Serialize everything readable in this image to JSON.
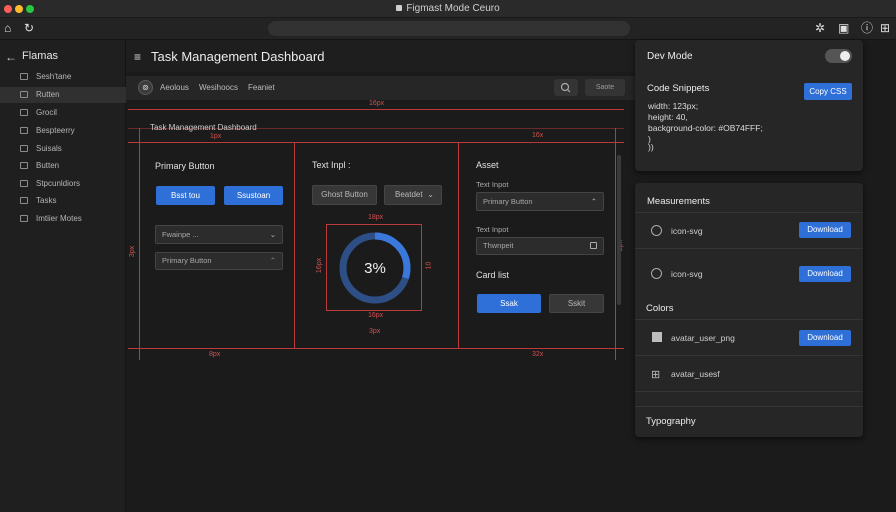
{
  "window": {
    "title": "Figmast Mode Ceuro"
  },
  "sidebar": {
    "title": "Flamas",
    "items": [
      {
        "label": "Sesh'tane"
      },
      {
        "label": "Rutten"
      },
      {
        "label": "Grocil"
      },
      {
        "label": "Bespteerry"
      },
      {
        "label": "Suisals"
      },
      {
        "label": "Butten"
      },
      {
        "label": "Stpcunldiors"
      },
      {
        "label": "Tasks"
      },
      {
        "label": "Imtiier Motes"
      }
    ]
  },
  "header": {
    "title": "Task Management Dashboard"
  },
  "subbar": {
    "tabs": [
      "Aeolous",
      "Wesihoocs",
      "Feaniet"
    ],
    "save_label": "Saote"
  },
  "canvas": {
    "frame_label": "Task Management Dashboard",
    "measure": {
      "top_16px": "16px",
      "top_1px": "1px",
      "right_16x": "16x",
      "left_3px": "3px",
      "bottom_8px": "8px",
      "bottom_32x": "32x",
      "inner_18px": "18px",
      "inner_16px_l": "16px",
      "inner_10": "10",
      "inner_16px_b": "16px",
      "inner_3px": "3px",
      "right_2px": "2px"
    },
    "primary": {
      "title": "Primary Button",
      "btn1": "Bsst tou",
      "btn2": "Ssustoan",
      "field1": "Fwainpe ...",
      "field2": "Primary Button"
    },
    "text_input": {
      "title": "Text Inpl :",
      "ghost_label": "Ghost Button",
      "dropdown_label": "Beatdet",
      "progress_value": "3%",
      "progress_fraction": 0.3
    },
    "asset": {
      "title": "Asset",
      "label1": "Text Inpot",
      "select_value": "Primary Button",
      "label2": "Text Inpot",
      "input_value": "Thwnpeit",
      "card_list_title": "Card list",
      "btn_primary": "Ssak",
      "btn_secondary": "Sskit"
    }
  },
  "right_panel": {
    "devmode": {
      "title": "Dev Mode",
      "snippets_title": "Code Snippets",
      "copy_label": "Copy CSS",
      "code": [
        "width: 123px;",
        "height: 40,",
        "background-color: #OB74FFF;",
        ")",
        "))"
      ]
    },
    "measurements": {
      "title": "Measurements",
      "rows": [
        {
          "label": "icon-svg",
          "button": "Download"
        },
        {
          "label": "icon-svg",
          "button": "Download"
        }
      ],
      "colors_title": "Colors",
      "color_rows": [
        {
          "label": "avatar_user_png",
          "button": "Download"
        },
        {
          "label": "avatar_usesf"
        }
      ],
      "typography_title": "Typography"
    }
  },
  "colors": {
    "accent": "#2f6fd8",
    "redline": "#b83a3a"
  }
}
